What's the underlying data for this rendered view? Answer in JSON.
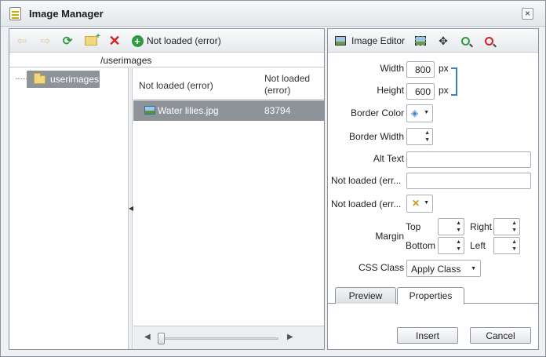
{
  "window": {
    "title": "Image Manager"
  },
  "file_browser": {
    "toolbar": {
      "status_label": "Not loaded (error)"
    },
    "path": "/userimages",
    "tree": {
      "folders": [
        "userimages"
      ]
    },
    "columns": [
      "Not loaded (error)",
      "Not loaded (error)"
    ],
    "files": [
      {
        "name": "Water lilies.jpg",
        "size": "83794"
      }
    ]
  },
  "image_editor": {
    "title": "Image Editor",
    "fields": {
      "width_label": "Width",
      "width_value": "800",
      "width_unit": "px",
      "height_label": "Height",
      "height_value": "600",
      "height_unit": "px",
      "border_color_label": "Border Color",
      "border_width_label": "Border Width",
      "alt_text_label": "Alt Text",
      "field5_label": "Not loaded (err...",
      "field6_label": "Not loaded (err...",
      "margin_label": "Margin",
      "margin_top": "Top",
      "margin_right": "Right",
      "margin_bottom": "Bottom",
      "margin_left": "Left",
      "css_class_label": "CSS Class",
      "css_class_value": "Apply Class"
    },
    "tabs": [
      "Preview",
      "Properties"
    ],
    "active_tab": "Properties"
  },
  "buttons": {
    "insert": "Insert",
    "cancel": "Cancel"
  },
  "colors": {
    "selection": "#8e9399",
    "accent_green": "#2e9a3e",
    "delete_red": "#d42020",
    "link_blue": "#3b7fc4"
  }
}
